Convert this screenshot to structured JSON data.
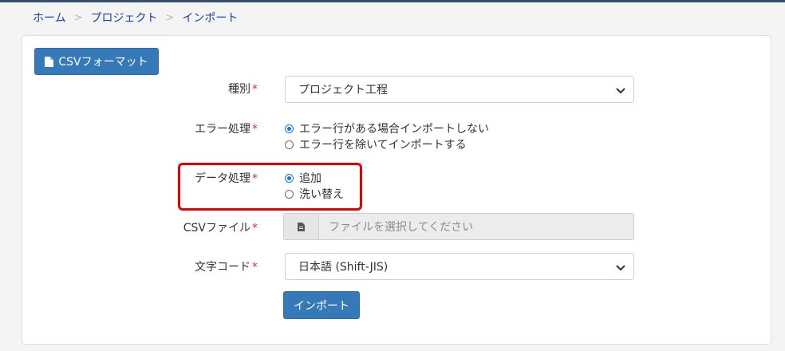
{
  "breadcrumb": {
    "home": "ホーム",
    "separator": ">",
    "project": "プロジェクト",
    "current": "インポート"
  },
  "csv_format_button": {
    "label": "CSVフォーマット",
    "icon": "document-icon"
  },
  "fields": {
    "type": {
      "label": "種別",
      "required_mark": "*",
      "value": "プロジェクト工程"
    },
    "error_handling": {
      "label": "エラー処理",
      "required_mark": "*",
      "options": [
        {
          "label": "エラー行がある場合インポートしない",
          "checked": true
        },
        {
          "label": "エラー行を除いてインポートする",
          "checked": false
        }
      ]
    },
    "data_handling": {
      "label": "データ処理",
      "required_mark": "*",
      "options": [
        {
          "label": "追加",
          "checked": true
        },
        {
          "label": "洗い替え",
          "checked": false
        }
      ]
    },
    "csv_file": {
      "label": "CSVファイル",
      "required_mark": "*",
      "placeholder": "ファイルを選択してください",
      "icon": "file-icon"
    },
    "encoding": {
      "label": "文字コード",
      "required_mark": "*",
      "value": "日本語 (Shift-JIS)"
    }
  },
  "import_button": {
    "label": "インポート"
  },
  "colors": {
    "primary": "#3579b8",
    "highlight": "#e50000",
    "required": "#c9302c",
    "link": "#1d3f9e"
  }
}
